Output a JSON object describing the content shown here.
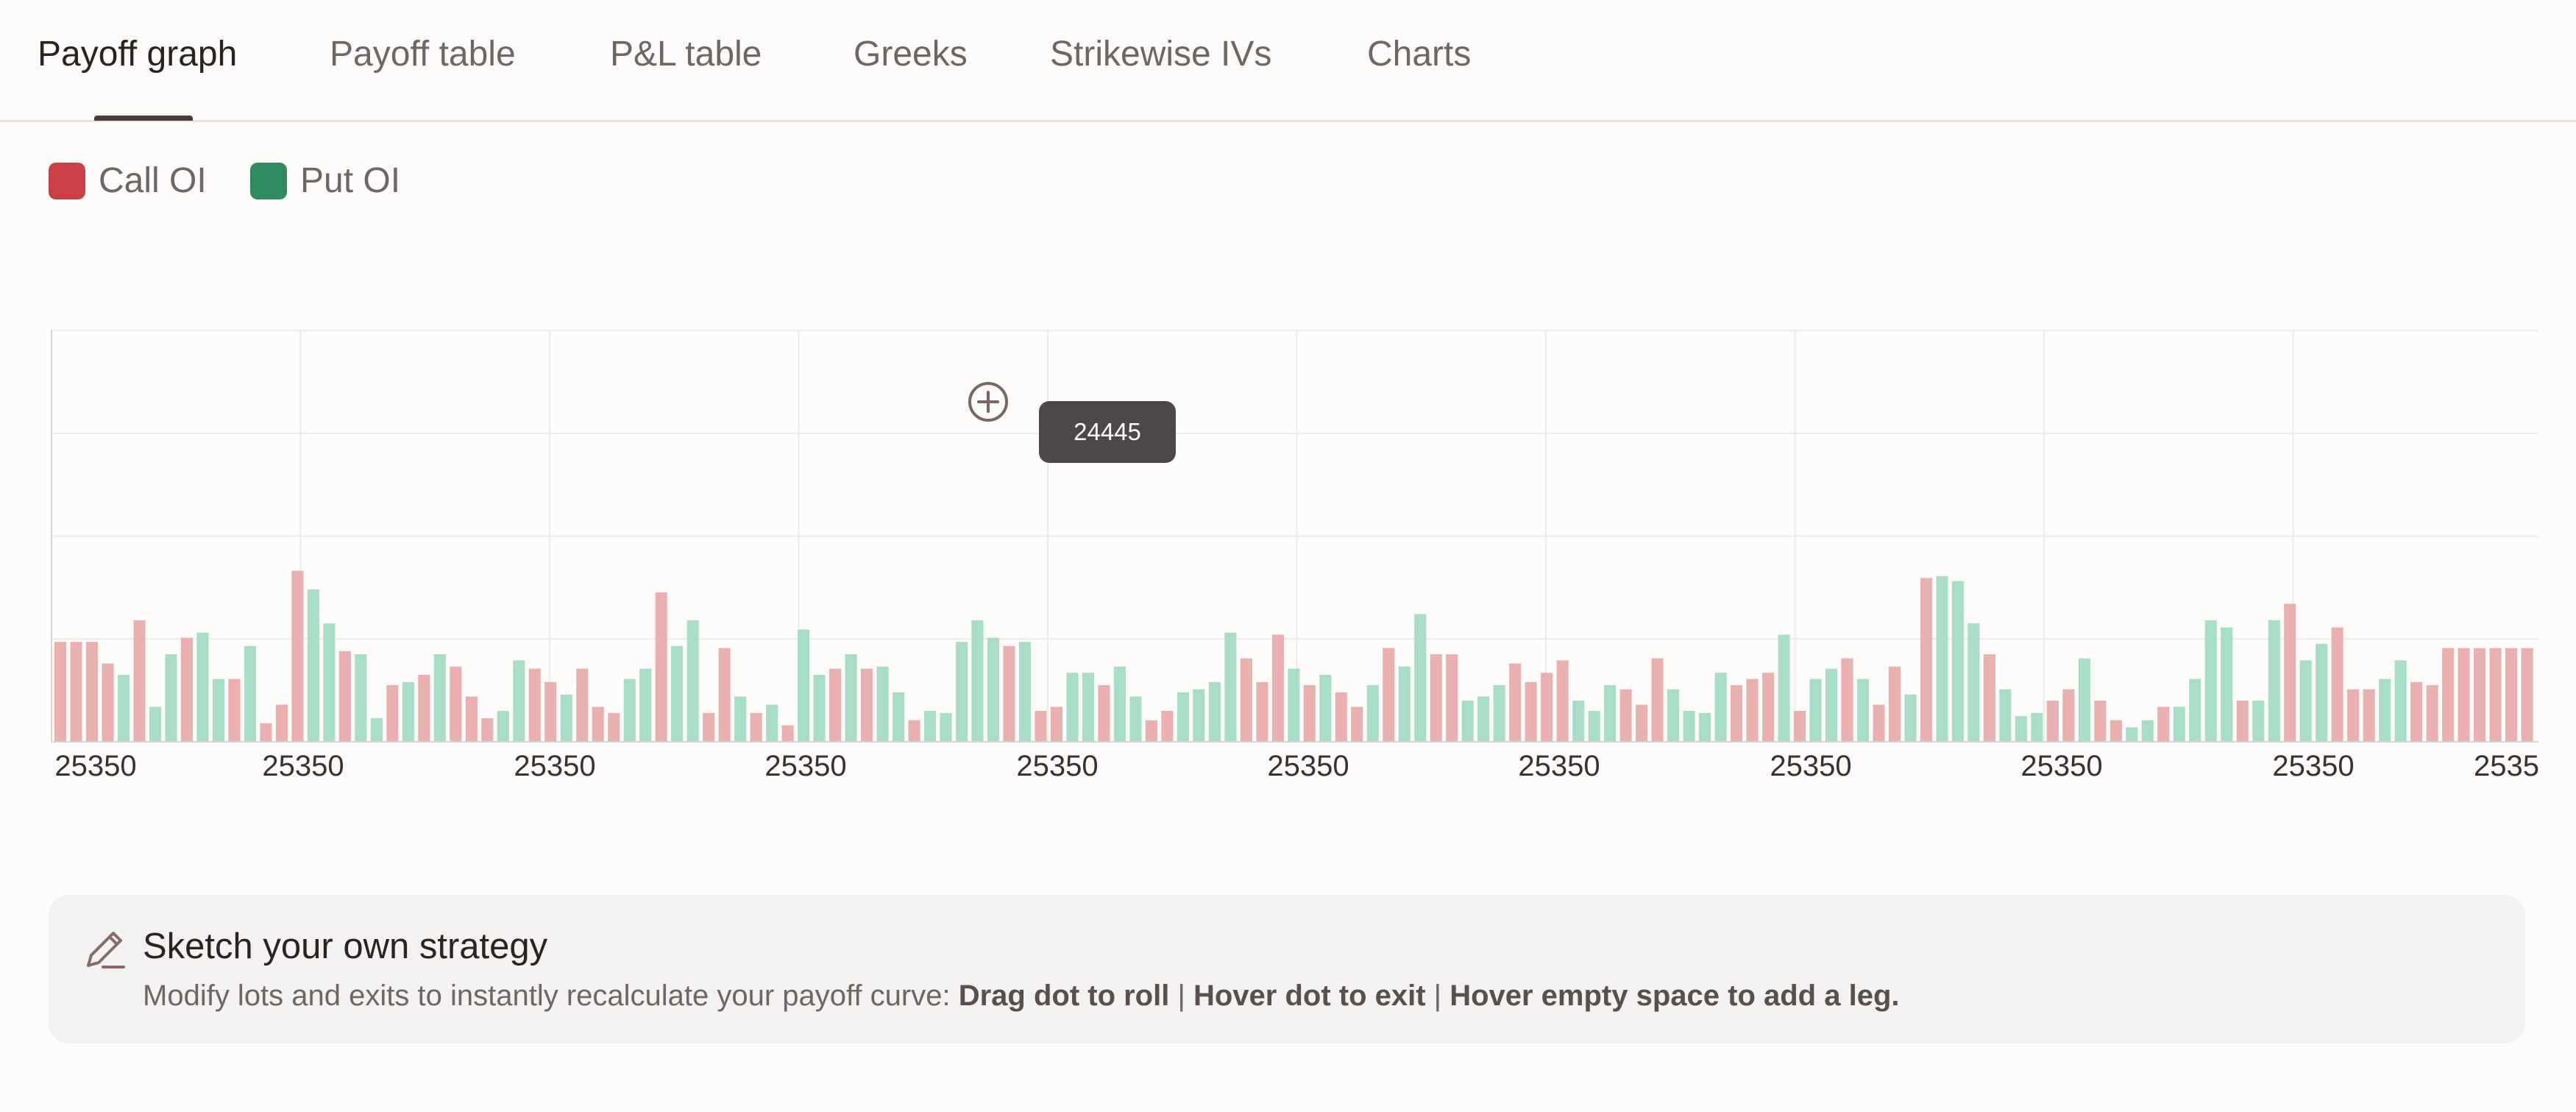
{
  "tabs": [
    {
      "label": "Payoff graph",
      "active": true
    },
    {
      "label": "Payoff table"
    },
    {
      "label": "P&L table"
    },
    {
      "label": "Greeks"
    },
    {
      "label": "Strikewise IVs"
    },
    {
      "label": "Charts"
    }
  ],
  "legend": {
    "call": {
      "label": "Call OI",
      "color": "#c94145"
    },
    "put": {
      "label": "Put OI",
      "color": "#2e8a5f"
    }
  },
  "tooltip": {
    "value": "24445"
  },
  "add_leg_icon": "plus-circle-icon",
  "sketch_card": {
    "icon": "pencil-icon",
    "title": "Sketch your own strategy",
    "desc_prefix": "Modify lots and exits to instantly recalculate your payoff curve: ",
    "action_roll": "Drag dot to roll",
    "sep1": " | ",
    "action_exit": "Hover dot to exit",
    "sep2": " | ",
    "action_add": "Hover empty space to add a leg."
  },
  "chart_data": {
    "type": "bar",
    "x_tick_labels": [
      "25350",
      "25350",
      "25350",
      "25350",
      "25350",
      "25350",
      "25350",
      "25350",
      "25350",
      "25350",
      "2535"
    ],
    "grid": true,
    "ylim": [
      0,
      400
    ],
    "series_colors": {
      "C": "#eaafaf",
      "P": "#a8ddc8"
    },
    "bars": [
      [
        "C",
        97
      ],
      [
        "C",
        97
      ],
      [
        "C",
        97
      ],
      [
        "C",
        76
      ],
      [
        "P",
        65
      ],
      [
        "C",
        118
      ],
      [
        "P",
        34
      ],
      [
        "P",
        85
      ],
      [
        "C",
        101
      ],
      [
        "P",
        106
      ],
      [
        "P",
        61
      ],
      [
        "C",
        61
      ],
      [
        "P",
        93
      ],
      [
        "C",
        18
      ],
      [
        "C",
        36
      ],
      [
        "C",
        166
      ],
      [
        "P",
        148
      ],
      [
        "P",
        115
      ],
      [
        "C",
        88
      ],
      [
        "P",
        85
      ],
      [
        "P",
        23
      ],
      [
        "C",
        55
      ],
      [
        "P",
        58
      ],
      [
        "C",
        65
      ],
      [
        "P",
        85
      ],
      [
        "C",
        73
      ],
      [
        "C",
        44
      ],
      [
        "C",
        23
      ],
      [
        "P",
        30
      ],
      [
        "P",
        79
      ],
      [
        "C",
        71
      ],
      [
        "C",
        58
      ],
      [
        "P",
        46
      ],
      [
        "C",
        71
      ],
      [
        "C",
        34
      ],
      [
        "C",
        28
      ],
      [
        "P",
        61
      ],
      [
        "P",
        71
      ],
      [
        "C",
        145
      ],
      [
        "P",
        93
      ],
      [
        "P",
        118
      ],
      [
        "C",
        28
      ],
      [
        "C",
        91
      ],
      [
        "P",
        44
      ],
      [
        "C",
        28
      ],
      [
        "P",
        36
      ],
      [
        "C",
        16
      ],
      [
        "P",
        109
      ],
      [
        "P",
        65
      ],
      [
        "C",
        71
      ],
      [
        "P",
        85
      ],
      [
        "C",
        71
      ],
      [
        "P",
        73
      ],
      [
        "P",
        48
      ],
      [
        "C",
        21
      ],
      [
        "P",
        30
      ],
      [
        "P",
        28
      ],
      [
        "P",
        97
      ],
      [
        "P",
        118
      ],
      [
        "P",
        101
      ],
      [
        "C",
        93
      ],
      [
        "P",
        97
      ],
      [
        "C",
        30
      ],
      [
        "C",
        34
      ],
      [
        "P",
        67
      ],
      [
        "P",
        67
      ],
      [
        "C",
        55
      ],
      [
        "P",
        73
      ],
      [
        "P",
        44
      ],
      [
        "C",
        21
      ],
      [
        "C",
        30
      ],
      [
        "P",
        48
      ],
      [
        "P",
        51
      ],
      [
        "P",
        58
      ],
      [
        "P",
        106
      ],
      [
        "C",
        81
      ],
      [
        "C",
        58
      ],
      [
        "C",
        104
      ],
      [
        "P",
        71
      ],
      [
        "C",
        55
      ],
      [
        "P",
        65
      ],
      [
        "C",
        48
      ],
      [
        "C",
        34
      ],
      [
        "P",
        55
      ],
      [
        "C",
        91
      ],
      [
        "P",
        73
      ],
      [
        "P",
        124
      ],
      [
        "C",
        85
      ],
      [
        "C",
        85
      ],
      [
        "P",
        40
      ],
      [
        "P",
        44
      ],
      [
        "P",
        55
      ],
      [
        "C",
        76
      ],
      [
        "C",
        58
      ],
      [
        "C",
        67
      ],
      [
        "C",
        79
      ],
      [
        "P",
        40
      ],
      [
        "P",
        30
      ],
      [
        "P",
        55
      ],
      [
        "C",
        51
      ],
      [
        "C",
        36
      ],
      [
        "C",
        81
      ],
      [
        "P",
        51
      ],
      [
        "P",
        30
      ],
      [
        "P",
        28
      ],
      [
        "P",
        67
      ],
      [
        "C",
        55
      ],
      [
        "C",
        61
      ],
      [
        "C",
        67
      ],
      [
        "P",
        104
      ],
      [
        "C",
        30
      ],
      [
        "P",
        61
      ],
      [
        "P",
        71
      ],
      [
        "C",
        81
      ],
      [
        "P",
        61
      ],
      [
        "C",
        36
      ],
      [
        "C",
        73
      ],
      [
        "P",
        46
      ],
      [
        "C",
        159
      ],
      [
        "P",
        161
      ],
      [
        "P",
        156
      ],
      [
        "P",
        115
      ],
      [
        "C",
        85
      ],
      [
        "P",
        51
      ],
      [
        "P",
        25
      ],
      [
        "P",
        28
      ],
      [
        "C",
        40
      ],
      [
        "C",
        51
      ],
      [
        "P",
        81
      ],
      [
        "C",
        40
      ],
      [
        "C",
        21
      ],
      [
        "P",
        14
      ],
      [
        "P",
        21
      ],
      [
        "C",
        34
      ],
      [
        "P",
        34
      ],
      [
        "P",
        61
      ],
      [
        "P",
        118
      ],
      [
        "P",
        111
      ],
      [
        "C",
        40
      ],
      [
        "P",
        40
      ],
      [
        "P",
        118
      ],
      [
        "C",
        134
      ],
      [
        "P",
        79
      ],
      [
        "P",
        95
      ],
      [
        "C",
        111
      ],
      [
        "C",
        51
      ],
      [
        "C",
        51
      ],
      [
        "P",
        61
      ],
      [
        "P",
        79
      ],
      [
        "C",
        58
      ],
      [
        "C",
        55
      ],
      [
        "C",
        91
      ],
      [
        "C",
        91
      ],
      [
        "C",
        91
      ],
      [
        "C",
        91
      ],
      [
        "C",
        91
      ],
      [
        "C",
        91
      ]
    ]
  }
}
